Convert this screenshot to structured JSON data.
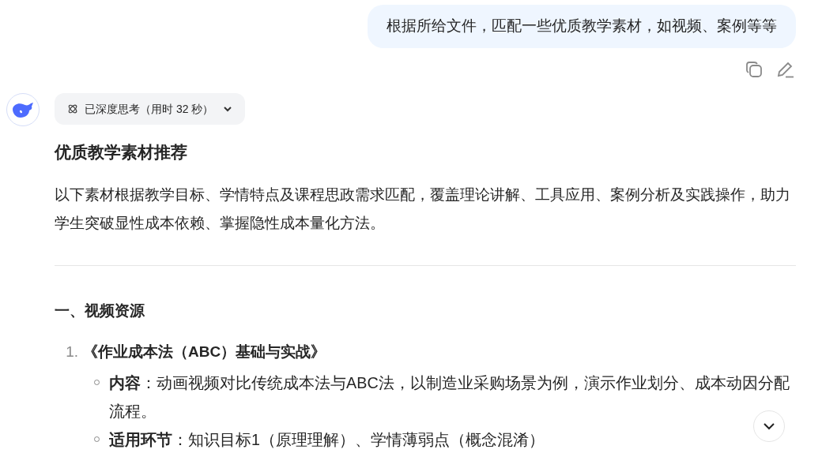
{
  "user_message": {
    "text": "根据所给文件，匹配一些优质教学素材，如视频、案例等等"
  },
  "thinking": {
    "label": "已深度思考（用时 32 秒）",
    "expanded": false
  },
  "answer": {
    "title": "优质教学素材推荐",
    "intro": "以下素材根据教学目标、学情特点及课程思政需求匹配，覆盖理论讲解、工具应用、案例分析及实践操作，助力学生突破显性成本依赖、掌握隐性成本量化方法。",
    "section": "一、视频资源",
    "items": [
      {
        "number": "1.",
        "title": "《作业成本法（ABC）基础与实战》",
        "details": [
          {
            "text": "**内容**：动画视频对比传统成本法与ABC法，以制造业采购场景为例，演示作业划分、成本动因分配流程。"
          },
          {
            "text": "**适用环节**：知识目标1（原理理解）、学情薄弱点（概念混淆）"
          }
        ]
      }
    ]
  }
}
